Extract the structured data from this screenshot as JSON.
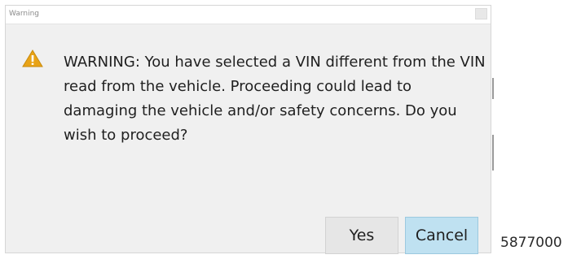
{
  "dialog": {
    "title": "Warning",
    "message": "WARNING:  You have selected a VIN different from the VIN read from the vehicle.  Proceeding could lead to damaging the vehicle and/or safety concerns.  Do you wish to proceed?",
    "icon": "warning-triangle-icon",
    "buttons": {
      "yes_label": "Yes",
      "cancel_label": "Cancel"
    }
  },
  "caption": "5877000",
  "colors": {
    "warning_icon": "#e8a317",
    "cancel_button": "#bfe1f1",
    "dialog_background": "#f0f0f0"
  }
}
